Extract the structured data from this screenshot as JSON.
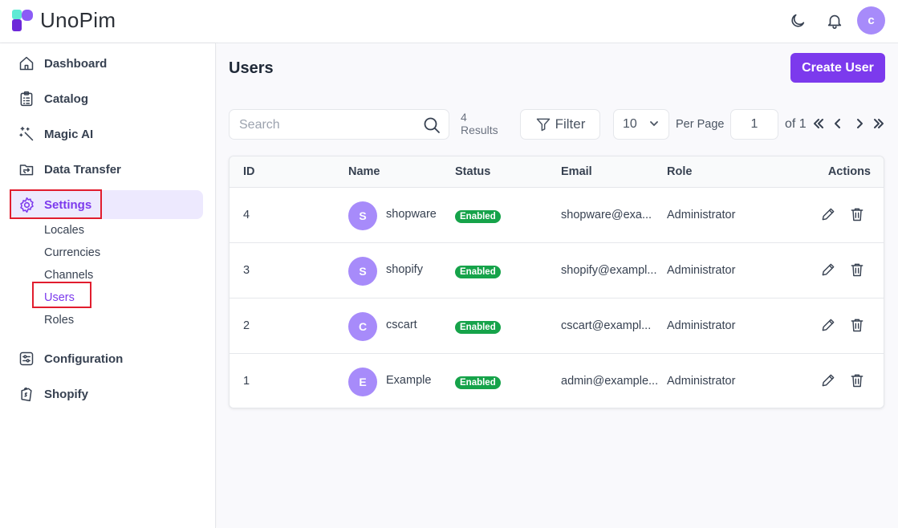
{
  "app": {
    "name": "UnoPim",
    "user_initial": "c"
  },
  "header": {
    "theme_icon": "moon-icon",
    "notification_icon": "bell-icon"
  },
  "sidebar": {
    "items": [
      {
        "label": "Dashboard",
        "icon": "home-icon"
      },
      {
        "label": "Catalog",
        "icon": "clipboard-list-icon"
      },
      {
        "label": "Magic AI",
        "icon": "magic-wand-icon"
      },
      {
        "label": "Data Transfer",
        "icon": "folder-transfer-icon"
      },
      {
        "label": "Settings",
        "icon": "gear-icon",
        "active": true
      },
      {
        "label": "Configuration",
        "icon": "sliders-icon"
      },
      {
        "label": "Shopify",
        "icon": "shopify-bag-icon"
      }
    ],
    "settings_children": [
      "Locales",
      "Currencies",
      "Channels",
      "Users",
      "Roles"
    ],
    "active_child": "Users"
  },
  "page": {
    "title": "Users",
    "create_button": "Create User",
    "search_placeholder": "Search",
    "results_count": "4",
    "results_label": "Results",
    "filter_label": "Filter",
    "per_page_value": "10",
    "per_page_label": "Per Page",
    "current_page": "1",
    "of_total": "of 1"
  },
  "table": {
    "columns": [
      "ID",
      "Name",
      "Status",
      "Email",
      "Role",
      "Actions"
    ],
    "rows": [
      {
        "id": "4",
        "initial": "S",
        "name": "shopware",
        "status": "Enabled",
        "email": "shopware@exa...",
        "role": "Administrator"
      },
      {
        "id": "3",
        "initial": "S",
        "name": "shopify",
        "status": "Enabled",
        "email": "shopify@exampl...",
        "role": "Administrator"
      },
      {
        "id": "2",
        "initial": "C",
        "name": "cscart",
        "status": "Enabled",
        "email": "cscart@exampl...",
        "role": "Administrator"
      },
      {
        "id": "1",
        "initial": "E",
        "name": "Example",
        "status": "Enabled",
        "email": "admin@example...",
        "role": "Administrator"
      }
    ]
  },
  "colors": {
    "accent": "#7c3aed",
    "avatar": "#a78bfa",
    "enabled_badge": "#16a34a",
    "highlight_box": "#e11d2e"
  }
}
